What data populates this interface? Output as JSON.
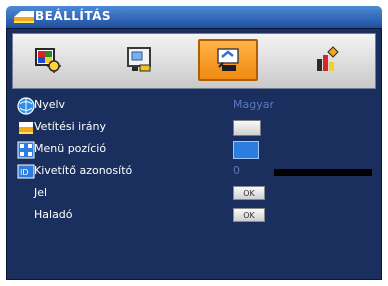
{
  "title": "BEÁLLÍTÁS",
  "tabs": [
    {
      "name": "image",
      "icon": "color-palette-monitor-icon",
      "active": false
    },
    {
      "name": "display",
      "icon": "screen-with-settings-icon",
      "active": false
    },
    {
      "name": "setup",
      "icon": "hand-adjusting-icon",
      "active": true
    },
    {
      "name": "options",
      "icon": "bars-with-diamond-icon",
      "active": false
    }
  ],
  "rows": [
    {
      "label": "Nyelv",
      "value": "Magyar",
      "icon": "globe-icon"
    },
    {
      "label": "Vetítési irány",
      "icon": "projector-icon"
    },
    {
      "label": "Menü pozíció",
      "icon": "grid-icon"
    },
    {
      "label": "Kivetítő azonosító",
      "value": "0",
      "icon": "id-badge-icon"
    },
    {
      "label": "Jel",
      "button": "OK"
    },
    {
      "label": "Haladó",
      "button": "OK"
    }
  ],
  "colors": {
    "accent": "#1e4f9e",
    "tab_active": "#f08a10",
    "panel": "#1b2f5e",
    "value": "#5a79bf"
  }
}
